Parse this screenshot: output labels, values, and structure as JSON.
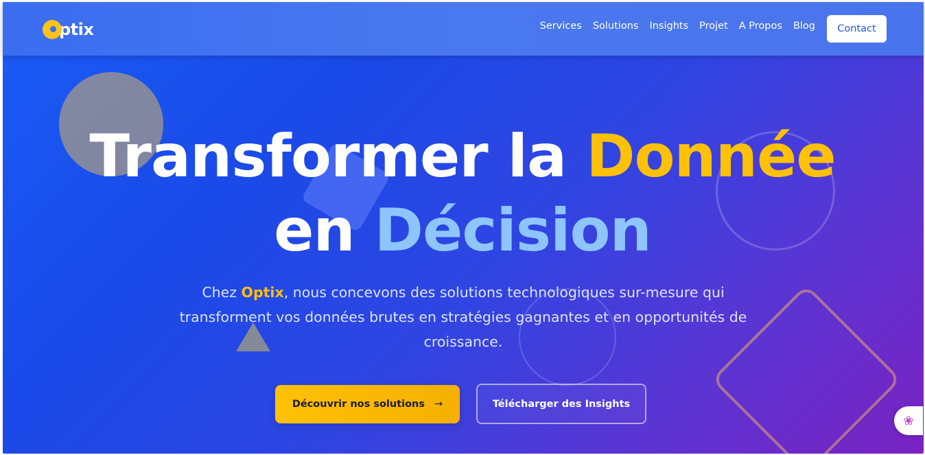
{
  "header": {
    "logo_text": "ptix",
    "nav": [
      {
        "label": "Services"
      },
      {
        "label": "Solutions"
      },
      {
        "label": "Insights"
      },
      {
        "label": "Projet"
      },
      {
        "label": "A Propos"
      },
      {
        "label": "Blog"
      }
    ],
    "contact_label": "Contact"
  },
  "hero": {
    "title_part1": "Transformer la ",
    "title_highlight1": "Donnée",
    "title_part2": "en ",
    "title_highlight2": "Décision",
    "subtitle_prefix": "Chez ",
    "subtitle_brand": "Optix",
    "subtitle_rest": ", nous concevons des solutions technologiques sur-mesure qui transforment vos données brutes en stratégies gagnantes et en opportunités de croissance.",
    "primary_button": "Découvrir nos solutions",
    "primary_button_arrow": "→",
    "secondary_button": "Télécharger des Insights"
  },
  "widget": {
    "icon": "brain-icon",
    "glyph": "❀"
  },
  "colors": {
    "accent_yellow": "#ffc107",
    "accent_lightblue": "#8ec5ff",
    "hero_start": "#1b5cf5",
    "hero_end": "#7a22c2"
  }
}
